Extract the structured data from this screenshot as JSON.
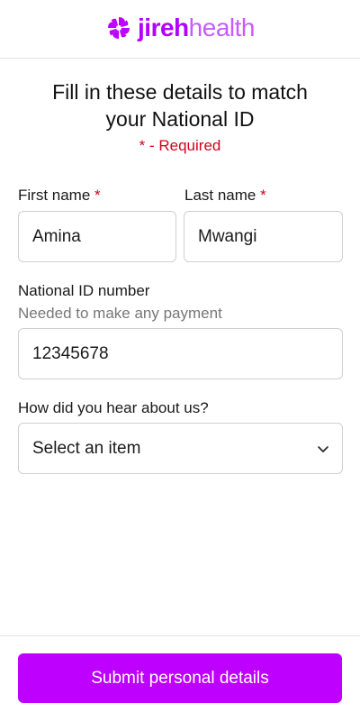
{
  "brand": {
    "name_bold": "jireh",
    "name_light": "health",
    "icon": "pinwheel-logo-icon",
    "color": "#bd00ff"
  },
  "form": {
    "title": "Fill in these details to match your National ID",
    "required_note": "* - Required",
    "first_name": {
      "label": "First name",
      "required_marker": "*",
      "value": "Amina"
    },
    "last_name": {
      "label": "Last name",
      "required_marker": "*",
      "value": "Mwangi"
    },
    "national_id": {
      "label": "National ID number",
      "helper": "Needed to make any payment",
      "value": "12345678"
    },
    "referral": {
      "label": "How did you hear about us?",
      "selected": "Select an item",
      "icon": "chevron-down-icon"
    }
  },
  "footer": {
    "submit_label": "Submit personal details"
  },
  "colors": {
    "accent": "#bd00ff",
    "required": "#d0021b",
    "helper_text": "#777777",
    "border": "#cfcfcf"
  }
}
